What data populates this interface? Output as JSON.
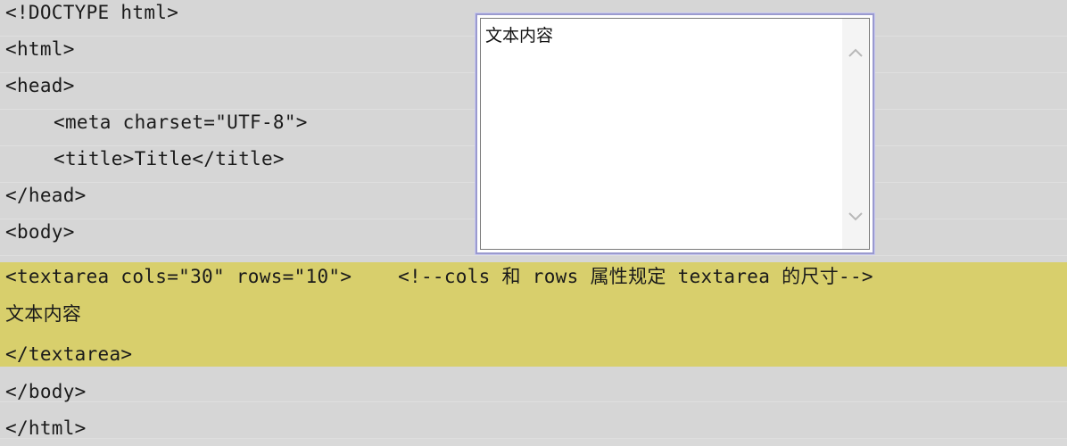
{
  "code_lines": [
    "<!DOCTYPE html>",
    "<html>",
    "<head>",
    "<meta charset=\"UTF-8\">",
    "<title>Title</title>",
    "</head>",
    "<body>",
    "<textarea cols=\"30\" rows=\"10\">    <!--cols 和 rows 属性规定 textarea 的尺寸-->",
    "文本内容",
    "</textarea>",
    "</body>",
    "</html>"
  ],
  "textarea_preview": {
    "text": "文本内容"
  },
  "colors": {
    "background": "#d9d9d9",
    "highlight": "#d8cf6c",
    "textarea_border": "#9a9acf"
  },
  "icons": {
    "scroll_up": "chevron-up-icon",
    "scroll_down": "chevron-down-icon"
  }
}
